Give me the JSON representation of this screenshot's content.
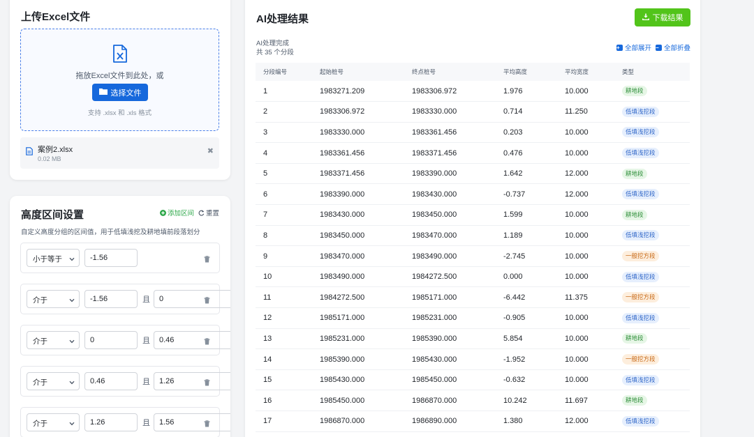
{
  "upload": {
    "title": "上传Excel文件",
    "drop_text": "拖放Excel文件到此处，或",
    "choose_button": "选择文件",
    "hint": "支持 .xlsx 和 .xls 格式",
    "file": {
      "name": "案例2.xlsx",
      "size": "0.02 MB"
    },
    "remove_glyph": "✖"
  },
  "range_settings": {
    "title": "高度区间设置",
    "add_label": "添加区间",
    "reset_label": "重置",
    "description": "自定义高度分组的区间值，用于低填浅挖及耕地填前段落划分",
    "and_label": "且",
    "items": [
      {
        "operator": "小于等于",
        "value1": "-1.56",
        "value2": ""
      },
      {
        "operator": "介于",
        "value1": "-1.56",
        "value2": "0"
      },
      {
        "operator": "介于",
        "value1": "0",
        "value2": "0.46"
      },
      {
        "operator": "介于",
        "value1": "0.46",
        "value2": "1.26"
      },
      {
        "operator": "介于",
        "value1": "1.26",
        "value2": "1.56"
      }
    ]
  },
  "results": {
    "title": "AI处理结果",
    "download_label": "下载结果",
    "status": "AI处理完成",
    "count": "共 35 个分段",
    "expand_all": "全部展开",
    "collapse_all": "全部折叠",
    "columns": [
      "分段编号",
      "起始桩号",
      "终点桩号",
      "平均高度",
      "平均宽度",
      "类型"
    ],
    "rows": [
      [
        "1",
        "1983271.209",
        "1983306.972",
        "1.976",
        "10.000",
        "耕地段"
      ],
      [
        "2",
        "1983306.972",
        "1983330.000",
        "0.714",
        "11.250",
        "低填浅挖段"
      ],
      [
        "3",
        "1983330.000",
        "1983361.456",
        "0.203",
        "10.000",
        "低填浅挖段"
      ],
      [
        "4",
        "1983361.456",
        "1983371.456",
        "0.476",
        "10.000",
        "低填浅挖段"
      ],
      [
        "5",
        "1983371.456",
        "1983390.000",
        "1.642",
        "12.000",
        "耕地段"
      ],
      [
        "6",
        "1983390.000",
        "1983430.000",
        "-0.737",
        "12.000",
        "低填浅挖段"
      ],
      [
        "7",
        "1983430.000",
        "1983450.000",
        "1.599",
        "10.000",
        "耕地段"
      ],
      [
        "8",
        "1983450.000",
        "1983470.000",
        "1.189",
        "10.000",
        "低填浅挖段"
      ],
      [
        "9",
        "1983470.000",
        "1983490.000",
        "-2.745",
        "10.000",
        "一般挖方段"
      ],
      [
        "10",
        "1983490.000",
        "1984272.500",
        "0.000",
        "10.000",
        "低填浅挖段"
      ],
      [
        "11",
        "1984272.500",
        "1985171.000",
        "-6.442",
        "11.375",
        "一般挖方段"
      ],
      [
        "12",
        "1985171.000",
        "1985231.000",
        "-0.905",
        "10.000",
        "低填浅挖段"
      ],
      [
        "13",
        "1985231.000",
        "1985390.000",
        "5.854",
        "10.000",
        "耕地段"
      ],
      [
        "14",
        "1985390.000",
        "1985430.000",
        "-1.952",
        "10.000",
        "一般挖方段"
      ],
      [
        "15",
        "1985430.000",
        "1985450.000",
        "-0.632",
        "10.000",
        "低填浅挖段"
      ],
      [
        "16",
        "1985450.000",
        "1986870.000",
        "10.242",
        "11.697",
        "耕地段"
      ],
      [
        "17",
        "1986870.000",
        "1986890.000",
        "1.380",
        "12.000",
        "低填浅挖段"
      ]
    ]
  },
  "colors": {
    "primary_blue": "#1668dc",
    "download_green": "#52c41a",
    "tag_farmland": "#2f8f3a",
    "tag_lowfill": "#2f66c8",
    "tag_cut": "#c86a18"
  }
}
